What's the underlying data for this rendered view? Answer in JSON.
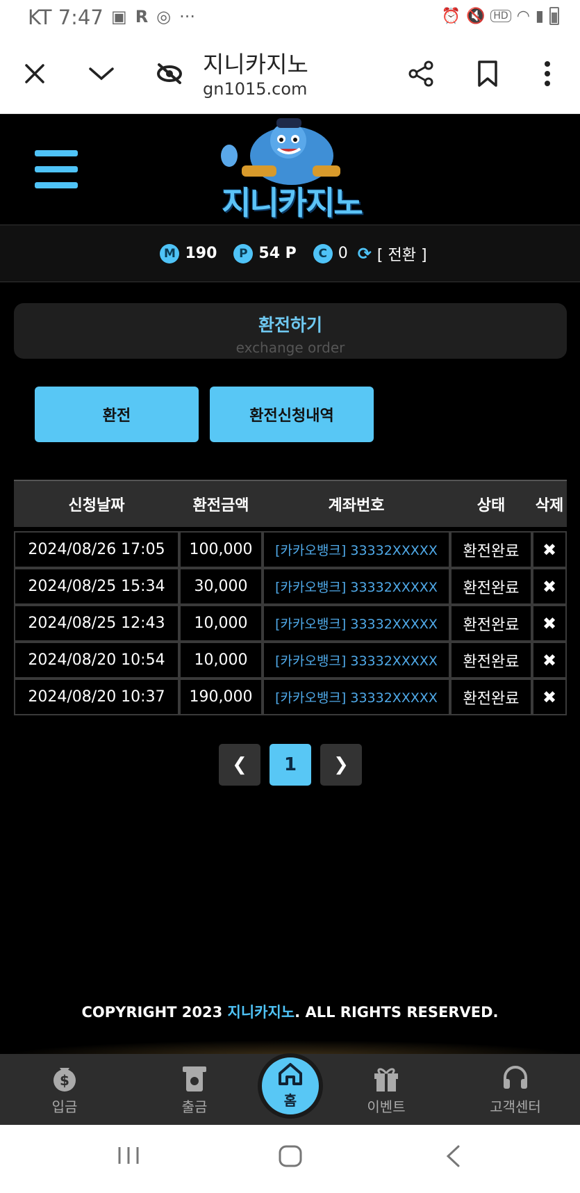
{
  "status_bar": {
    "carrier_time": "KT 7:47",
    "notif_icons": [
      "image-icon",
      "r-icon",
      "chrome-icon"
    ],
    "more": "···",
    "right_icons": [
      "alarm-icon",
      "mute-icon",
      "hd-icon",
      "wifi-icon",
      "signal-icon",
      "battery-icon"
    ]
  },
  "browser": {
    "title": "지니카지노",
    "url": "gn1015.com"
  },
  "site": {
    "logo_text": "지니카지노"
  },
  "balance": {
    "m_badge": "M",
    "m_value": "190",
    "p_badge": "P",
    "p_value": "54 P",
    "c_badge": "C",
    "c_value": "0",
    "convert": "[ 전환 ]"
  },
  "section": {
    "title": "환전하기",
    "subtitle": "exchange order"
  },
  "tabs": {
    "exchange": "환전",
    "history": "환전신청내역"
  },
  "table": {
    "headers": [
      "신청날짜",
      "환전금액",
      "계좌번호",
      "상태",
      "삭제"
    ],
    "rows": [
      {
        "date": "2024/08/26 17:05",
        "amount": "100,000",
        "account": "[카카오뱅크] 33332XXXXX",
        "status": "환전완료",
        "del": "✖"
      },
      {
        "date": "2024/08/25 15:34",
        "amount": "30,000",
        "account": "[카카오뱅크] 33332XXXXX",
        "status": "환전완료",
        "del": "✖"
      },
      {
        "date": "2024/08/25 12:43",
        "amount": "10,000",
        "account": "[카카오뱅크] 33332XXXXX",
        "status": "환전완료",
        "del": "✖"
      },
      {
        "date": "2024/08/20 10:54",
        "amount": "10,000",
        "account": "[카카오뱅크] 33332XXXXX",
        "status": "환전완료",
        "del": "✖"
      },
      {
        "date": "2024/08/20 10:37",
        "amount": "190,000",
        "account": "[카카오뱅크] 33332XXXXX",
        "status": "환전완료",
        "del": "✖"
      }
    ]
  },
  "pagination": {
    "prev": "❮",
    "current": "1",
    "next": "❯"
  },
  "footer": {
    "copyright_prefix": "COPYRIGHT 2023 ",
    "brand": "지니카지노",
    "copyright_suffix": ". ALL RIGHTS RESERVED."
  },
  "bottom_nav": {
    "deposit": "입금",
    "withdraw": "출금",
    "home": "홈",
    "event": "이벤트",
    "support": "고객센터"
  },
  "colors": {
    "accent": "#58c7f5",
    "background": "#000000",
    "link": "#4fa9e8"
  }
}
